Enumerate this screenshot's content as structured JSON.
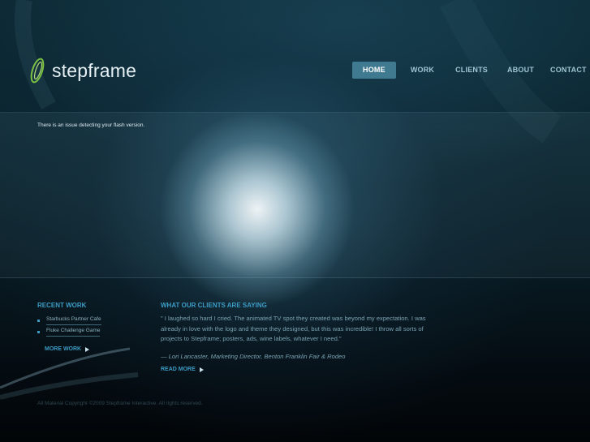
{
  "brand": {
    "name": "stepframe"
  },
  "nav": {
    "items": [
      {
        "label": "HOME",
        "active": true
      },
      {
        "label": "WORK",
        "active": false
      },
      {
        "label": "CLIENTS",
        "active": false
      },
      {
        "label": "ABOUT",
        "active": false
      },
      {
        "label": "CONTACT",
        "active": false
      }
    ]
  },
  "flash": {
    "message": "There is an issue detecting your flash version."
  },
  "recent_work": {
    "title": "RECENT WORK",
    "items": [
      "Starbucks Partner Cafe",
      "Fluke Challenge Game"
    ],
    "more_label": "MORE WORK"
  },
  "testimonials": {
    "title": "WHAT OUR CLIENTS ARE SAYING",
    "quote": "\" I laughed so hard I cried. The animated TV spot they created was beyond my expectation. I was already in love with the logo and theme they designed, but this was incredible! I throw all sorts of projects to Stepframe; posters, ads, wine labels, whatever I need.\"",
    "attribution": "— Lori Lancaster, Marketing Director, Benton Franklin Fair & Rodeo",
    "more_label": "READ MORE"
  },
  "footer": {
    "copyright": "All Material Copyright ©2009 Stepframe Interactive. All rights reserved."
  },
  "colors": {
    "accent": "#3d9cc4",
    "nav_active_bg": "#3f7a90",
    "nav_text": "#9fc4d2"
  }
}
